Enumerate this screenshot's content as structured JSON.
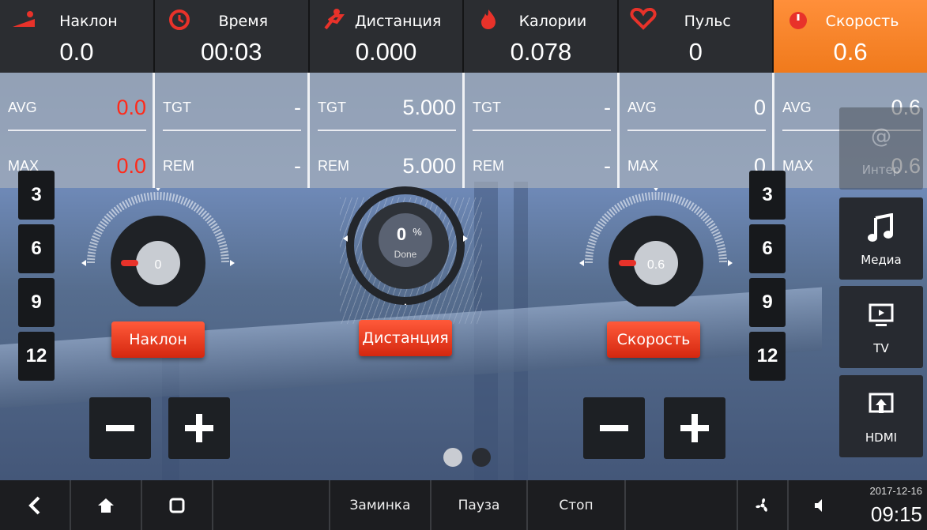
{
  "stats": [
    {
      "label": "Наклон",
      "value": "0.0",
      "icon": "incline-icon"
    },
    {
      "label": "Время",
      "value": "00:03",
      "icon": "clock-icon"
    },
    {
      "label": "Дистанция",
      "value": "0.000",
      "icon": "runner-icon"
    },
    {
      "label": "Калории",
      "value": "0.078",
      "icon": "flame-icon"
    },
    {
      "label": "Пульс",
      "value": "0",
      "icon": "heart-icon"
    },
    {
      "label": "Скорость",
      "value": "0.6",
      "icon": "speedometer-icon"
    }
  ],
  "substats": [
    {
      "k1": "AVG",
      "v1": "0.0",
      "k2": "MAX",
      "v2": "0.0"
    },
    {
      "k1": "TGT",
      "v1": "-",
      "k2": "REM",
      "v2": "-"
    },
    {
      "k1": "TGT",
      "v1": "5.000",
      "k2": "REM",
      "v2": "5.000"
    },
    {
      "k1": "TGT",
      "v1": "-",
      "k2": "REM",
      "v2": "-"
    },
    {
      "k1": "AVG",
      "v1": "0",
      "k2": "MAX",
      "v2": "0"
    },
    {
      "k1": "AVG",
      "v1": "0.6",
      "k2": "MAX",
      "v2": "0.6"
    }
  ],
  "left_levels": [
    "3",
    "6",
    "9",
    "12"
  ],
  "right_levels": [
    "3",
    "6",
    "9",
    "12"
  ],
  "gauges": {
    "incline": {
      "value": "0",
      "button": "Наклон"
    },
    "distance": {
      "value": "0",
      "unit": "%",
      "sub": "Done",
      "button": "Дистанция"
    },
    "speed": {
      "value": "0.6",
      "button": "Скорость"
    }
  },
  "right_panel": [
    {
      "label": "Интер",
      "icon": "internet-icon"
    },
    {
      "label": "Медиа",
      "icon": "music-icon"
    },
    {
      "label": "TV",
      "icon": "tv-icon"
    },
    {
      "label": "HDMI",
      "icon": "hdmi-icon"
    }
  ],
  "nav": {
    "cooldown": "Заминка",
    "pause": "Пауза",
    "stop": "Стоп",
    "date": "2017-12-16",
    "time": "09:15"
  },
  "colors": {
    "accent": "#f07a1c",
    "red": "#ff2a1a",
    "button": "#e0301a"
  }
}
